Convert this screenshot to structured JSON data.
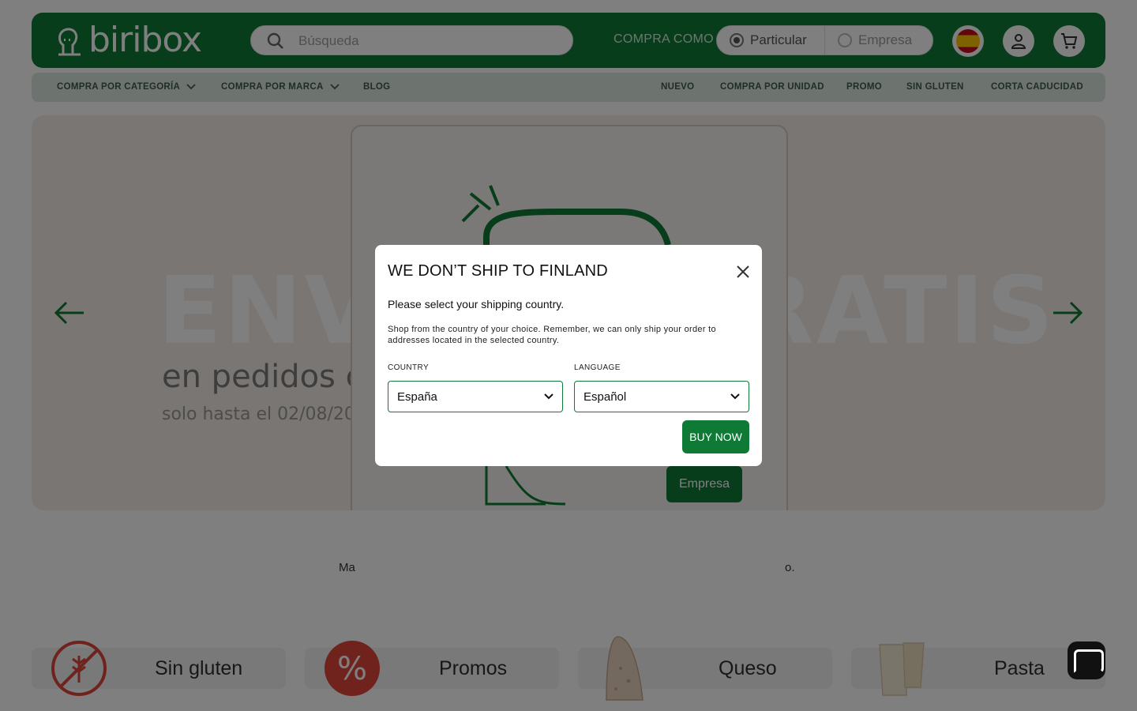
{
  "brand": {
    "name": "biribox",
    "color": "#0e7a36"
  },
  "header": {
    "search_placeholder": "Búsqueda",
    "buy_as_label": "COMPRA COMO",
    "customer_types": [
      "Particular",
      "Empresa"
    ],
    "selected_customer_type": "Particular",
    "icons": [
      "spain-flag-icon",
      "user-icon",
      "cart-icon"
    ]
  },
  "nav": {
    "left": [
      "COMPRA POR CATEGORÍA",
      "COMPRA POR MARCA",
      "BLOG"
    ],
    "right": [
      "NUEVO",
      "COMPRA POR UNIDAD",
      "PROMO",
      "SIN GLUTEN",
      "CORTA CADUCIDAD"
    ]
  },
  "hero": {
    "title_left": "ENV",
    "title_right": "RATIS",
    "subtitle": "en pedidos c",
    "subtitle2": "solo hasta el 02/08/20",
    "card_button": "Empresa"
  },
  "below_text": {
    "left": "Ma",
    "right": "o."
  },
  "categories": [
    {
      "label": "Sin gluten",
      "icon": "no-gluten-icon"
    },
    {
      "label": "Promos",
      "icon": "percent-icon"
    },
    {
      "label": "Queso",
      "icon": "cheese-image"
    },
    {
      "label": "Pasta",
      "icon": "pasta-image"
    }
  ],
  "modal": {
    "title": "WE DON’T SHIP TO FINLAND",
    "subtitle": "Please select your shipping country.",
    "note": "Shop from the country of your choice. Remember, we can only ship your order to addresses located in the selected country.",
    "country_label": "COUNTRY",
    "country_value": "España",
    "language_label": "LANGUAGE",
    "language_value": "Español",
    "buy_button": "BUY NOW"
  }
}
